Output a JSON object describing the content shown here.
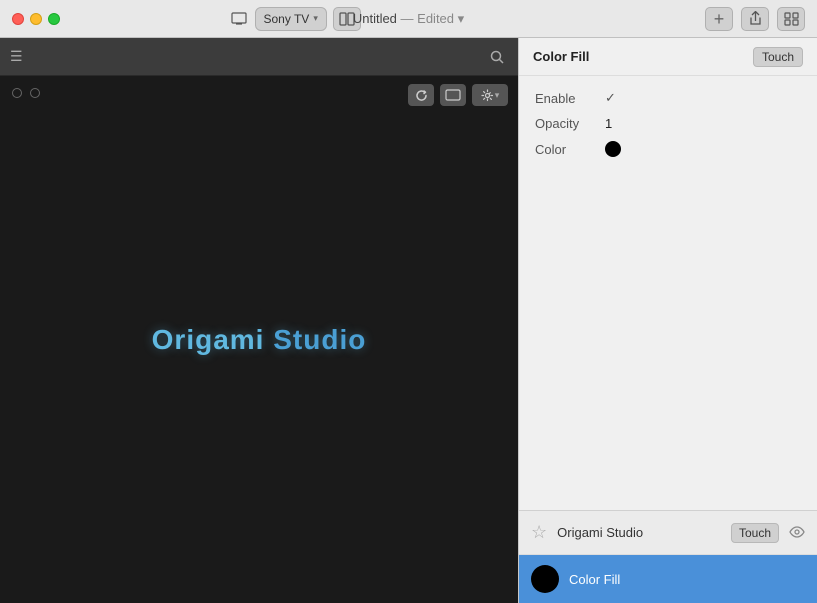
{
  "titlebar": {
    "device": "Sony TV",
    "title": "Untitled",
    "edited_label": "— Edited ▾",
    "add_btn_label": "+",
    "share_icon": "↑",
    "layout_icon": "⊞"
  },
  "left_panel": {
    "preview_text_origami": "Origami",
    "preview_text_studio": " Studio",
    "toolbar": {
      "refresh_icon": "↺",
      "device_icon": "▭",
      "settings_icon": "⚙"
    }
  },
  "right_panel": {
    "header": {
      "title": "Color Fill",
      "touch_btn": "Touch"
    },
    "properties": {
      "enable_label": "Enable",
      "enable_value": "✓",
      "opacity_label": "Opacity",
      "opacity_value": "1",
      "color_label": "Color",
      "color_value": ""
    },
    "bottom": {
      "layer_name": "Origami Studio",
      "layer_touch": "Touch",
      "color_fill_label": "Color Fill"
    }
  }
}
